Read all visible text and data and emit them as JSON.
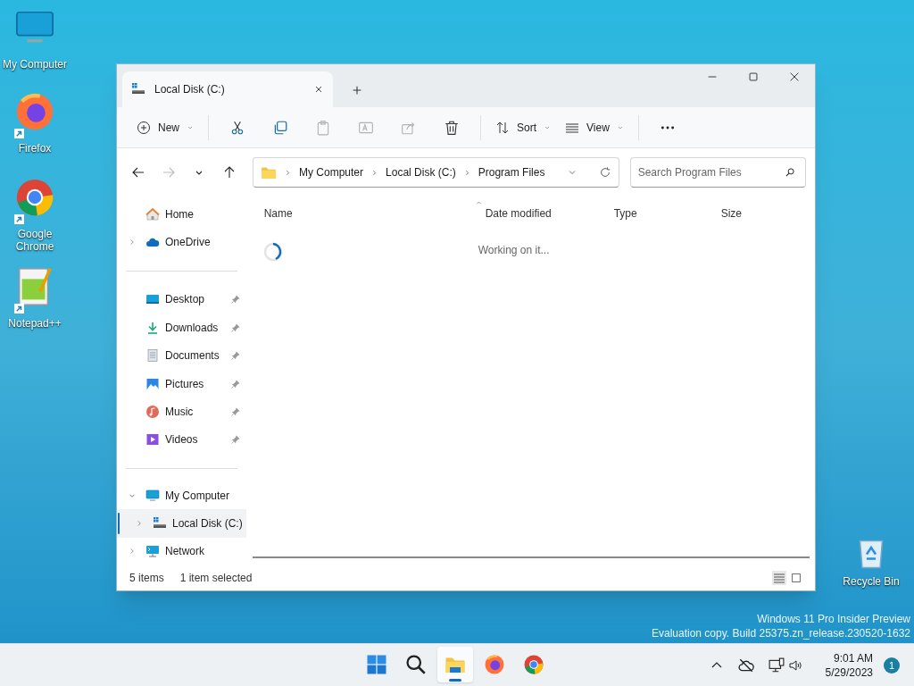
{
  "desktop_icons": [
    {
      "kind": "computer",
      "label": "My Computer",
      "shortcut": false
    },
    {
      "kind": "firefox",
      "label": "Firefox",
      "shortcut": true
    },
    {
      "kind": "chrome",
      "label": "Google Chrome",
      "shortcut": true
    },
    {
      "kind": "notepad",
      "label": "Notepad++",
      "shortcut": true
    }
  ],
  "recycle_bin": {
    "label": "Recycle Bin"
  },
  "window": {
    "tab": {
      "title": "Local Disk (C:)"
    },
    "toolbar": [
      {
        "kind": "new",
        "label": "New",
        "disabled": false
      },
      {
        "kind": "cut",
        "disabled": false
      },
      {
        "kind": "copy",
        "disabled": false
      },
      {
        "kind": "paste",
        "disabled": true
      },
      {
        "kind": "rename",
        "disabled": true
      },
      {
        "kind": "share",
        "disabled": true
      },
      {
        "kind": "delete",
        "disabled": false
      },
      {
        "kind": "sort",
        "label": "Sort",
        "disabled": false
      },
      {
        "kind": "view",
        "label": "View",
        "disabled": false
      },
      {
        "kind": "more",
        "disabled": false
      }
    ],
    "navigation": {
      "back_disabled": false,
      "forward_disabled": true
    },
    "address": {
      "crumbs": [
        "My Computer",
        "Local Disk (C:)",
        "Program Files"
      ]
    },
    "search": {
      "placeholder": "Search Program Files"
    },
    "columns": [
      {
        "label": "Name",
        "sorted": true
      },
      {
        "label": "Date modified",
        "sorted": false
      },
      {
        "label": "Type",
        "sorted": false
      },
      {
        "label": "Size",
        "sorted": false
      }
    ],
    "loading_text": "Working on it...",
    "sidebar": {
      "top": [
        {
          "kind": "home",
          "label": "Home",
          "expandable": false
        },
        {
          "kind": "onedrive",
          "label": "OneDrive",
          "expandable": true
        }
      ],
      "pinned": [
        {
          "kind": "desktop",
          "label": "Desktop"
        },
        {
          "kind": "downloads",
          "label": "Downloads"
        },
        {
          "kind": "documents",
          "label": "Documents"
        },
        {
          "kind": "pictures",
          "label": "Pictures"
        },
        {
          "kind": "music",
          "label": "Music"
        },
        {
          "kind": "videos",
          "label": "Videos"
        }
      ],
      "tree": [
        {
          "kind": "computer",
          "label": "My Computer",
          "expanded": true,
          "selected": false,
          "children": [
            {
              "kind": "disk",
              "label": "Local Disk (C:)",
              "expanded": false,
              "selected": true
            }
          ]
        },
        {
          "kind": "network",
          "label": "Network",
          "expanded": false,
          "selected": false
        }
      ]
    },
    "status_bar": {
      "count": "5 items",
      "selection": "1 item selected"
    }
  },
  "watermark": [
    "Windows 11 Pro Insider Preview",
    "Evaluation copy. Build 25375.zn_release.230520-1632"
  ],
  "taskbar": {
    "apps": [
      {
        "kind": "start",
        "active": false
      },
      {
        "kind": "search",
        "active": false
      },
      {
        "kind": "explorer",
        "active": true
      },
      {
        "kind": "firefox",
        "active": false
      },
      {
        "kind": "chrome",
        "active": false
      }
    ],
    "time": "9:01 AM",
    "date": "5/29/2023",
    "notifications": "1"
  }
}
